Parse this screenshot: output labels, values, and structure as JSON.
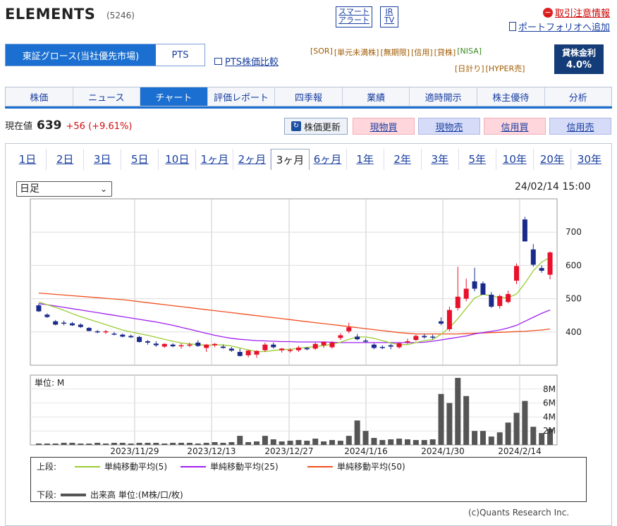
{
  "header": {
    "title": "ELEMENTS",
    "code": "(5246)",
    "smart_alert": [
      "スマート",
      "アラート"
    ],
    "irtv": [
      "IR",
      "TV"
    ],
    "alert_link": "取引注意情報",
    "portfolio_link": "ポートフォリオへ追加"
  },
  "market": {
    "selected": "東証グロース(当社優先市場)",
    "pts": "PTS",
    "pts_compare": "PTS株価比較"
  },
  "badges_row1": [
    "[SOR]",
    "[単元未満株]",
    "[無期限]",
    "[信用]",
    "[貸株]",
    "[NISA]"
  ],
  "badges_row2": [
    "[日計り]",
    "[HYPER売]"
  ],
  "lending": {
    "label": "貸株金利",
    "rate": "4.0%"
  },
  "tabs": [
    "株価",
    "ニュース",
    "チャート",
    "評価レポート",
    "四季報",
    "業績",
    "適時開示",
    "株主優待",
    "分析"
  ],
  "active_tab": "チャート",
  "quote": {
    "label": "現在値",
    "price": "639",
    "change": "+56 (+9.61%)"
  },
  "refresh_label": "株価更新",
  "trade_buttons": [
    "現物買",
    "現物売",
    "信用買",
    "信用売"
  ],
  "periods": [
    "1日",
    "2日",
    "3日",
    "5日",
    "10日",
    "1ヶ月",
    "2ヶ月",
    "3ヶ月",
    "6ヶ月",
    "1年",
    "2年",
    "3年",
    "5年",
    "10年",
    "20年",
    "30年"
  ],
  "active_period": "3ヶ月",
  "interval_select": "日足",
  "timestamp": "24/02/14 15:00",
  "legend": {
    "upper_label": "上段:",
    "lower_label": "下段:",
    "ma5": "単純移動平均(5)",
    "ma25": "単純移動平均(25)",
    "ma50": "単純移動平均(50)",
    "volume": "出来高 単位:(M株/口/枚)"
  },
  "volume_unit_label": "単位: M",
  "credit": "(c)Quants Research Inc.",
  "colors": {
    "up": "#e8102a",
    "down": "#1a2a8a",
    "ma5": "#9acd32",
    "ma25": "#a020f0",
    "ma50": "#f05020",
    "volume": "#555555",
    "accent": "#1a6fd0"
  },
  "chart_data": {
    "type": "candlestick",
    "price_ylim": [
      300,
      800
    ],
    "price_ticks": [
      400,
      500,
      600,
      700
    ],
    "volume_ylim": [
      0,
      10
    ],
    "volume_ticks": [
      "2M",
      "4M",
      "6M",
      "8M"
    ],
    "x_labels": [
      "2023/11/29",
      "2023/12/13",
      "2023/12/27",
      "2024/1/16",
      "2024/1/30",
      "2024/2/14"
    ],
    "candles": [
      {
        "o": 480,
        "h": 485,
        "l": 460,
        "c": 462
      },
      {
        "o": 452,
        "h": 456,
        "l": 442,
        "c": 445
      },
      {
        "o": 432,
        "h": 436,
        "l": 420,
        "c": 422
      },
      {
        "o": 428,
        "h": 434,
        "l": 420,
        "c": 425
      },
      {
        "o": 426,
        "h": 430,
        "l": 418,
        "c": 420
      },
      {
        "o": 422,
        "h": 426,
        "l": 412,
        "c": 415
      },
      {
        "o": 412,
        "h": 415,
        "l": 402,
        "c": 403
      },
      {
        "o": 402,
        "h": 406,
        "l": 396,
        "c": 400
      },
      {
        "o": 400,
        "h": 406,
        "l": 394,
        "c": 402
      },
      {
        "o": 395,
        "h": 400,
        "l": 390,
        "c": 393
      },
      {
        "o": 392,
        "h": 395,
        "l": 384,
        "c": 386
      },
      {
        "o": 388,
        "h": 392,
        "l": 382,
        "c": 384
      },
      {
        "o": 385,
        "h": 388,
        "l": 368,
        "c": 370
      },
      {
        "o": 372,
        "h": 376,
        "l": 362,
        "c": 368
      },
      {
        "o": 365,
        "h": 372,
        "l": 355,
        "c": 360
      },
      {
        "o": 356,
        "h": 366,
        "l": 352,
        "c": 364
      },
      {
        "o": 362,
        "h": 366,
        "l": 354,
        "c": 357
      },
      {
        "o": 357,
        "h": 366,
        "l": 350,
        "c": 360
      },
      {
        "o": 359,
        "h": 368,
        "l": 354,
        "c": 362
      },
      {
        "o": 368,
        "h": 375,
        "l": 355,
        "c": 358
      },
      {
        "o": 352,
        "h": 364,
        "l": 340,
        "c": 362
      },
      {
        "o": 360,
        "h": 367,
        "l": 354,
        "c": 364
      },
      {
        "o": 356,
        "h": 362,
        "l": 350,
        "c": 352
      },
      {
        "o": 350,
        "h": 355,
        "l": 340,
        "c": 344
      },
      {
        "o": 340,
        "h": 350,
        "l": 326,
        "c": 328
      },
      {
        "o": 330,
        "h": 346,
        "l": 324,
        "c": 344
      },
      {
        "o": 332,
        "h": 345,
        "l": 322,
        "c": 343
      },
      {
        "o": 345,
        "h": 368,
        "l": 340,
        "c": 362
      },
      {
        "o": 362,
        "h": 368,
        "l": 350,
        "c": 354
      },
      {
        "o": 345,
        "h": 352,
        "l": 338,
        "c": 350
      },
      {
        "o": 343,
        "h": 350,
        "l": 338,
        "c": 346
      },
      {
        "o": 345,
        "h": 358,
        "l": 340,
        "c": 353
      },
      {
        "o": 352,
        "h": 355,
        "l": 345,
        "c": 348
      },
      {
        "o": 350,
        "h": 368,
        "l": 346,
        "c": 364
      },
      {
        "o": 360,
        "h": 372,
        "l": 352,
        "c": 370
      },
      {
        "o": 354,
        "h": 372,
        "l": 350,
        "c": 368
      },
      {
        "o": 382,
        "h": 396,
        "l": 376,
        "c": 390
      },
      {
        "o": 402,
        "h": 428,
        "l": 396,
        "c": 414
      },
      {
        "o": 386,
        "h": 394,
        "l": 375,
        "c": 378
      },
      {
        "o": 374,
        "h": 380,
        "l": 368,
        "c": 371
      },
      {
        "o": 362,
        "h": 366,
        "l": 348,
        "c": 352
      },
      {
        "o": 355,
        "h": 360,
        "l": 348,
        "c": 352
      },
      {
        "o": 360,
        "h": 365,
        "l": 348,
        "c": 356
      },
      {
        "o": 354,
        "h": 368,
        "l": 350,
        "c": 366
      },
      {
        "o": 370,
        "h": 380,
        "l": 364,
        "c": 372
      },
      {
        "o": 376,
        "h": 392,
        "l": 372,
        "c": 388
      },
      {
        "o": 388,
        "h": 394,
        "l": 380,
        "c": 384
      },
      {
        "o": 386,
        "h": 392,
        "l": 378,
        "c": 385
      },
      {
        "o": 432,
        "h": 444,
        "l": 420,
        "c": 425
      },
      {
        "o": 408,
        "h": 476,
        "l": 402,
        "c": 466
      },
      {
        "o": 472,
        "h": 596,
        "l": 464,
        "c": 506
      },
      {
        "o": 500,
        "h": 560,
        "l": 492,
        "c": 530
      },
      {
        "o": 552,
        "h": 593,
        "l": 522,
        "c": 530
      },
      {
        "o": 546,
        "h": 552,
        "l": 512,
        "c": 512
      },
      {
        "o": 512,
        "h": 520,
        "l": 472,
        "c": 476
      },
      {
        "o": 478,
        "h": 512,
        "l": 470,
        "c": 508
      },
      {
        "o": 490,
        "h": 524,
        "l": 486,
        "c": 514
      },
      {
        "o": 554,
        "h": 606,
        "l": 544,
        "c": 598
      },
      {
        "o": 738,
        "h": 746,
        "l": 672,
        "c": 672
      },
      {
        "o": 648,
        "h": 664,
        "l": 596,
        "c": 602
      },
      {
        "o": 592,
        "h": 600,
        "l": 578,
        "c": 584
      },
      {
        "o": 572,
        "h": 642,
        "l": 558,
        "c": 639
      }
    ],
    "ma5": [
      490,
      482,
      474,
      465,
      455,
      446,
      438,
      430,
      422,
      414,
      406,
      400,
      395,
      390,
      384,
      378,
      372,
      367,
      364,
      362,
      360,
      361,
      361,
      358,
      352,
      346,
      341,
      341,
      344,
      347,
      348,
      351,
      354,
      356,
      359,
      363,
      369,
      378,
      385,
      385,
      381,
      374,
      367,
      362,
      362,
      368,
      374,
      377,
      393,
      413,
      440,
      471,
      502,
      513,
      509,
      503,
      503,
      514,
      546,
      584,
      610,
      624
    ],
    "ma25": [
      485,
      482,
      478,
      474,
      470,
      466,
      462,
      458,
      454,
      450,
      446,
      442,
      438,
      434,
      430,
      425,
      420,
      414,
      408,
      402,
      396,
      390,
      385,
      381,
      378,
      376,
      374,
      373,
      372,
      371,
      371,
      370,
      370,
      370,
      370,
      369,
      368,
      368,
      368,
      368,
      368,
      368,
      368,
      368,
      368,
      368,
      369,
      372,
      376,
      380,
      384,
      388,
      394,
      398,
      402,
      406,
      412,
      420,
      432,
      444,
      456,
      466
    ],
    "ma50": [
      517,
      515,
      513,
      511,
      509,
      507,
      505,
      503,
      501,
      499,
      497,
      494,
      491,
      488,
      485,
      482,
      479,
      476,
      473,
      470,
      467,
      464,
      461,
      458,
      455,
      452,
      449,
      446,
      443,
      440,
      437,
      434,
      431,
      428,
      425,
      422,
      419,
      416,
      413,
      410,
      407,
      404,
      401,
      398,
      396,
      394,
      394,
      394,
      394,
      394,
      394,
      395,
      396,
      397,
      398,
      399,
      400,
      401,
      402,
      404,
      406,
      409
    ],
    "volume": [
      0.2,
      0.2,
      0.2,
      0.3,
      0.3,
      0.2,
      0.2,
      0.3,
      0.2,
      0.3,
      0.3,
      0.2,
      0.3,
      0.3,
      0.3,
      0.2,
      0.3,
      0.3,
      0.3,
      0.2,
      0.3,
      0.4,
      0.3,
      0.4,
      1.3,
      0.4,
      0.5,
      1.3,
      0.8,
      0.5,
      0.6,
      0.7,
      0.6,
      0.9,
      0.5,
      0.7,
      0.6,
      1.3,
      3.5,
      2.0,
      1.0,
      0.7,
      0.8,
      0.9,
      0.8,
      0.7,
      0.7,
      0.8,
      7.3,
      6.0,
      9.6,
      7.0,
      2.0,
      2.0,
      1.2,
      1.8,
      3.2,
      4.6,
      6.3,
      2.6,
      1.7,
      2.3
    ]
  }
}
